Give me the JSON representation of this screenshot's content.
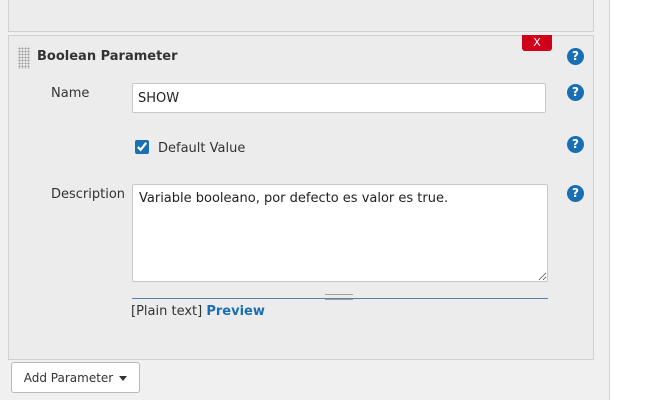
{
  "parameter": {
    "title": "Boolean Parameter",
    "delete_label": "X",
    "help_label": "?",
    "name_label": "Name",
    "name_value": "SHOW",
    "default_value_label": "Default Value",
    "default_value_checked": true,
    "description_label": "Description",
    "description_value": "Variable booleano, por defecto es valor es true.",
    "format_text": "[Plain text]",
    "preview_label": "Preview"
  },
  "footer": {
    "add_parameter_label": "Add Parameter"
  },
  "colors": {
    "help_icon": "#1a6fb3",
    "delete_button": "#d0001b",
    "link": "#1a6fb3"
  }
}
